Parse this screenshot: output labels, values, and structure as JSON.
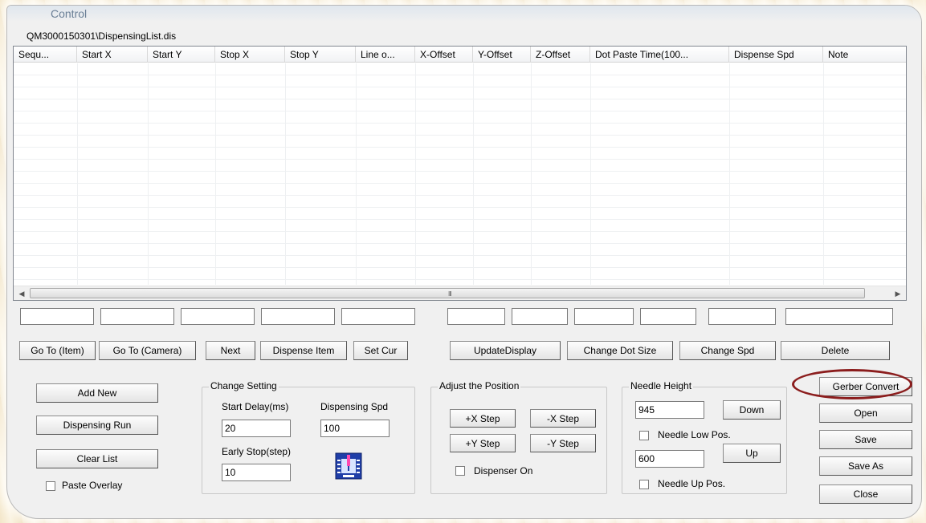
{
  "window": {
    "title": "Control",
    "path": "QM3000150301\\DispensingList.dis"
  },
  "list": {
    "columns": [
      "Sequ...",
      "Start X",
      "Start Y",
      "Stop X",
      "Stop Y",
      "Line o...",
      "X-Offset",
      "Y-Offset",
      "Z-Offset",
      "Dot Paste Time(100...",
      "Dispense Spd",
      "Note"
    ],
    "rows": [],
    "scroll_grip": "III"
  },
  "edit_row": [
    "",
    "",
    "",
    "",
    "",
    "",
    "",
    "",
    "",
    "",
    ""
  ],
  "action_buttons": {
    "go_to_item": "Go To (Item)",
    "go_to_camera": "Go To (Camera)",
    "next": "Next",
    "dispense_item": "Dispense Item",
    "set_cur": "Set Cur",
    "update_display": "UpdateDisplay",
    "change_dot_size": "Change Dot Size",
    "change_spd": "Change Spd",
    "delete": "Delete"
  },
  "left_buttons": {
    "add_new": "Add New",
    "dispensing_run": "Dispensing Run",
    "clear_list": "Clear List",
    "paste_overlay": "Paste Overlay"
  },
  "change_setting": {
    "label": "Change Setting",
    "start_delay_label": "Start Delay(ms)",
    "start_delay_value": "20",
    "dispensing_spd_label": "Dispensing Spd",
    "dispensing_spd_value": "100",
    "early_stop_label": "Early Stop(step)",
    "early_stop_value": "10"
  },
  "adjust_position": {
    "label": "Adjust the Position",
    "plus_x": "+X Step",
    "minus_x": "-X Step",
    "plus_y": "+Y Step",
    "minus_y": "-Y Step",
    "dispenser_on": "Dispenser On"
  },
  "needle_height": {
    "label": "Needle Height",
    "low_value": "945",
    "down": "Down",
    "needle_low_pos": "Needle Low Pos.",
    "up_value": "600",
    "up": "Up",
    "needle_up_pos": "Needle Up Pos."
  },
  "right_buttons": {
    "gerber_convert": "Gerber Convert",
    "open": "Open",
    "save": "Save",
    "save_as": "Save As",
    "close": "Close"
  },
  "colors": {
    "highlight_oval": "#8b1d1d",
    "chip_icon": "#1f3ea8"
  }
}
